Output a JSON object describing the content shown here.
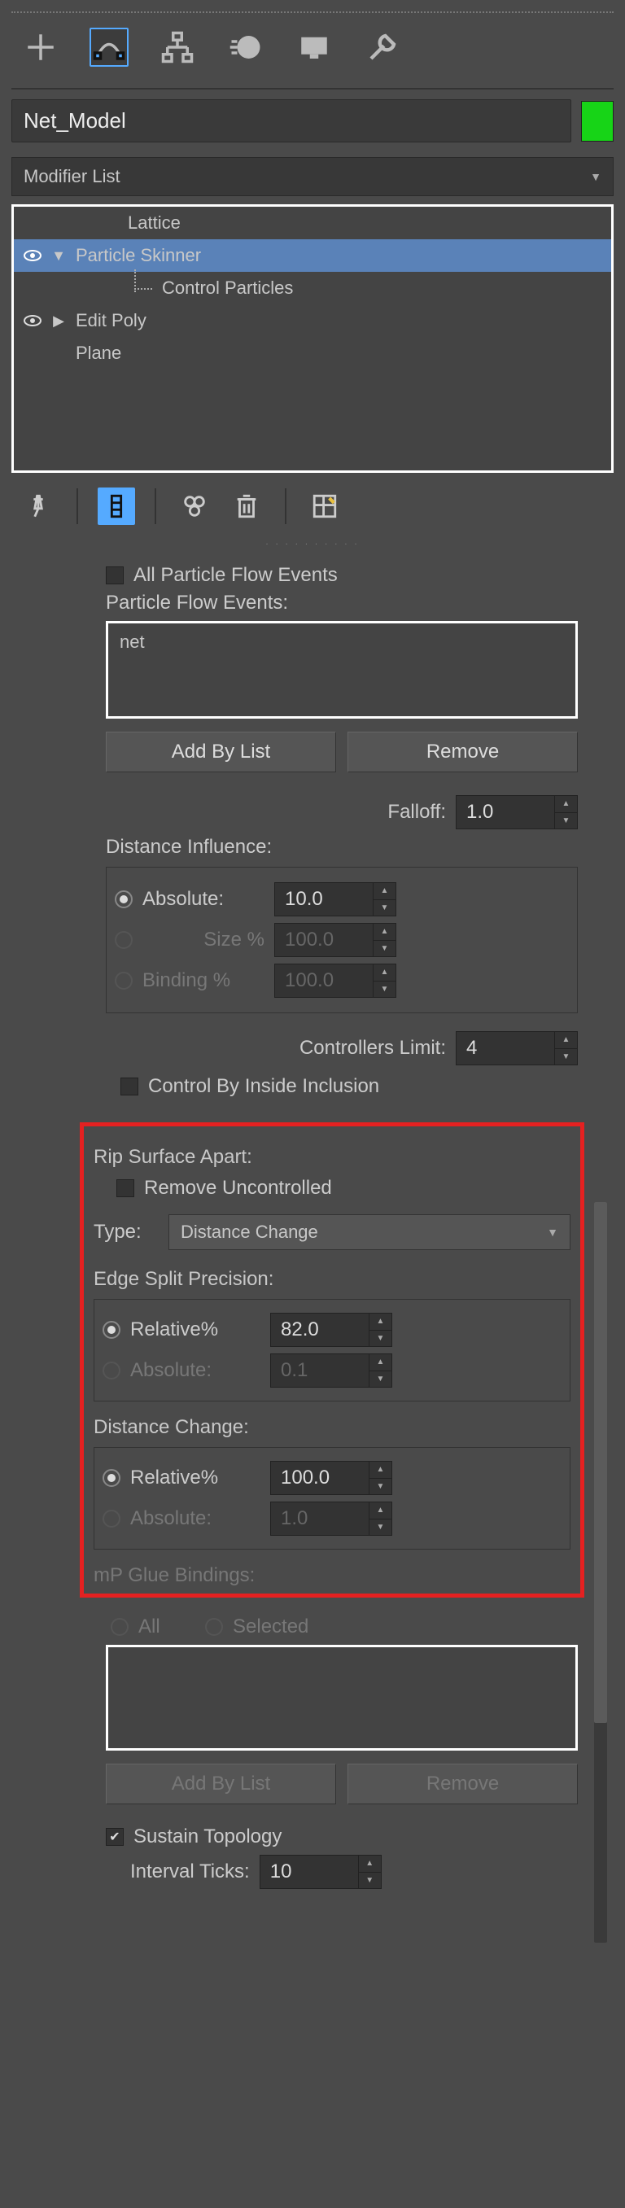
{
  "object_name": "Net_Model",
  "modifier_list_label": "Modifier List",
  "stack": {
    "lattice": "Lattice",
    "particle_skinner": "Particle Skinner",
    "control_particles": "Control Particles",
    "edit_poly": "Edit Poly",
    "plane": "Plane"
  },
  "params": {
    "all_pf_events": "All Particle Flow Events",
    "pf_events_label": "Particle Flow Events:",
    "pf_event_item": "net",
    "add_by_list": "Add By List",
    "remove": "Remove",
    "falloff_label": "Falloff:",
    "falloff_value": "1.0",
    "distance_influence": "Distance Influence:",
    "absolute_label": "Absolute:",
    "absolute_value": "10.0",
    "size_pct_label": "Size %",
    "size_pct_value": "100.0",
    "binding_pct_label": "Binding %",
    "binding_pct_value": "100.0",
    "controllers_limit_label": "Controllers Limit:",
    "controllers_limit_value": "4",
    "control_by_inside": "Control By Inside Inclusion",
    "rip_surface": "Rip Surface Apart:",
    "remove_uncontrolled": "Remove Uncontrolled",
    "type_label": "Type:",
    "type_value": "Distance Change",
    "edge_split_precision": "Edge Split Precision:",
    "relative_pct_label": "Relative%",
    "esp_relative_value": "82.0",
    "esp_absolute_value": "0.1",
    "distance_change": "Distance Change:",
    "dc_relative_value": "100.0",
    "dc_absolute_value": "1.0",
    "mp_glue_bindings": "mP Glue Bindings:",
    "all_label": "All",
    "selected_label": "Selected",
    "sustain_topology": "Sustain Topology",
    "interval_ticks_label": "Interval Ticks:",
    "interval_ticks_value": "10"
  }
}
